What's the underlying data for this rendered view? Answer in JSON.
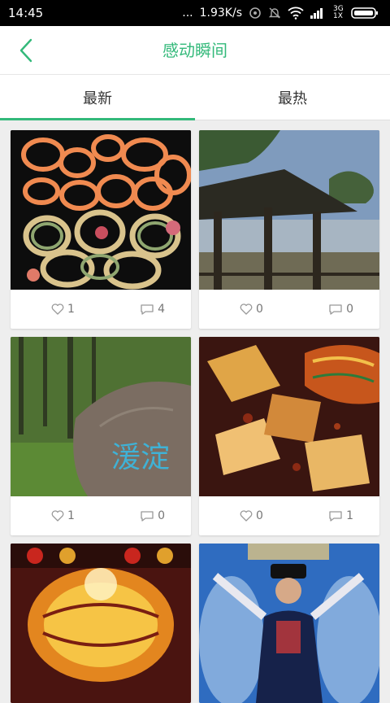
{
  "status_bar": {
    "time": "14:45",
    "dots": "...",
    "speed": "1.93K/s",
    "network": "3G 1X"
  },
  "nav": {
    "title": "感动瞬间"
  },
  "tabs": [
    {
      "label": "最新",
      "active": true
    },
    {
      "label": "最热",
      "active": false
    }
  ],
  "cards": [
    {
      "likes": "1",
      "comments": "4"
    },
    {
      "likes": "0",
      "comments": "0"
    },
    {
      "likes": "1",
      "comments": "0"
    },
    {
      "likes": "0",
      "comments": "1"
    }
  ],
  "photo_text": {
    "stone_calligraphy": "湲淀"
  },
  "colors": {
    "accent": "#33b97a",
    "status_bg": "#000000",
    "page_bg": "#eeeeee"
  }
}
